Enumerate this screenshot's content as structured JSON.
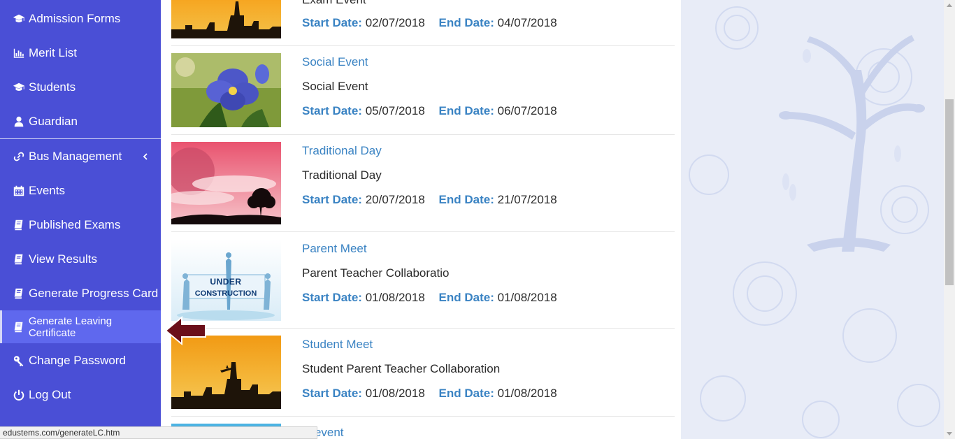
{
  "sidebar": {
    "items": [
      {
        "label": "Admission Forms",
        "icon": "graduation-cap-icon"
      },
      {
        "label": "Merit List",
        "icon": "bar-chart-icon"
      },
      {
        "label": "Students",
        "icon": "graduation-cap-icon"
      },
      {
        "label": "Guardian",
        "icon": "user-icon"
      },
      {
        "label": "Bus Management",
        "icon": "link-icon"
      },
      {
        "label": "Events",
        "icon": "calendar-icon"
      },
      {
        "label": "Published Exams",
        "icon": "book-icon"
      },
      {
        "label": "View Results",
        "icon": "book-icon"
      },
      {
        "label": "Generate Progress Card",
        "icon": "book-icon"
      },
      {
        "label": "Generate Leaving Certificate",
        "icon": "book-icon"
      },
      {
        "label": "Change Password",
        "icon": "key-icon"
      },
      {
        "label": "Log Out",
        "icon": "power-icon"
      }
    ],
    "active_index": 9,
    "colors": {
      "background": "#4a4fd6",
      "active": "#5f68ee"
    }
  },
  "labels": {
    "start": "Start Date:",
    "end": "End Date:"
  },
  "events": [
    {
      "title": "",
      "description": "Exam Event",
      "start": "02/07/2018",
      "end": "04/07/2018",
      "image": "city-sunset"
    },
    {
      "title": "Social Event",
      "description": "Social Event",
      "start": "05/07/2018",
      "end": "06/07/2018",
      "image": "violet-flower"
    },
    {
      "title": "Traditional Day",
      "description": "Traditional Day",
      "start": "20/07/2018",
      "end": "21/07/2018",
      "image": "pink-moon-tree"
    },
    {
      "title": "Parent Meet",
      "description": "Parent Teacher Collaboratio",
      "start": "01/08/2018",
      "end": "01/08/2018",
      "image": "under-construction"
    },
    {
      "title": "Student Meet",
      "description": "Student Parent Teacher Collaboration",
      "start": "01/08/2018",
      "end": "01/08/2018",
      "image": "city-sunset"
    },
    {
      "title": "st event",
      "description": "",
      "start": "",
      "end": "",
      "image": "blue-partial"
    }
  ],
  "thumb_texts": {
    "under_construction": "UNDER CONSTRUCTION"
  },
  "statusbar": {
    "url": "edustems.com/generateLC.htm"
  },
  "colors": {
    "link": "#3a83c3",
    "text": "#2b2b2b",
    "arrow": "#6b0f1a"
  }
}
